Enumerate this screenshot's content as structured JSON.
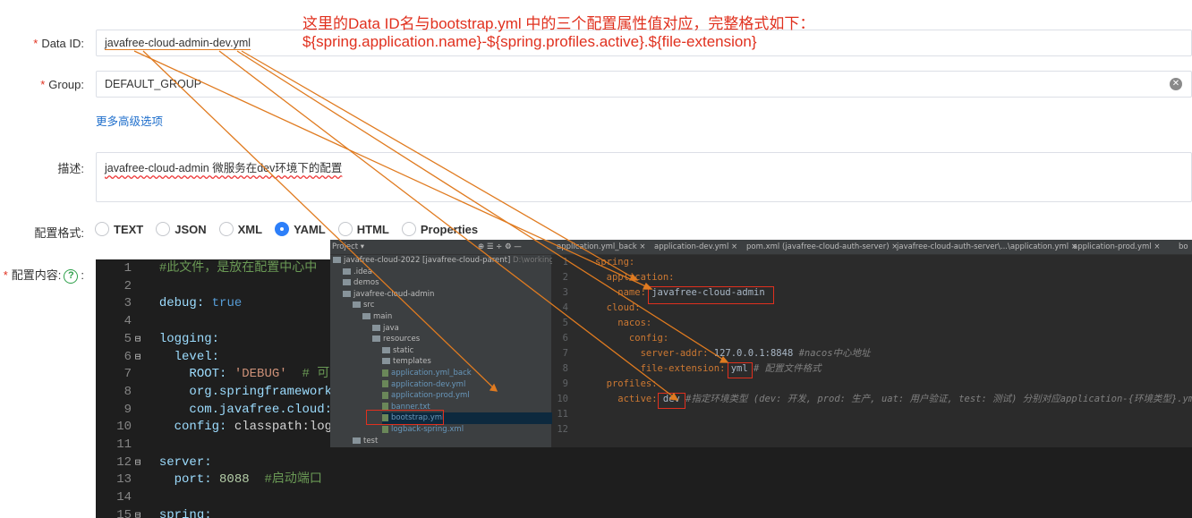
{
  "form": {
    "data_id_label": "Data ID:",
    "data_id_value": "javafree-cloud-admin-dev.yml",
    "group_label": "Group:",
    "group_value": "DEFAULT_GROUP",
    "advanced_link": "更多高级选项",
    "desc_label": "描述:",
    "desc_value": "javafree-cloud-admin 微服务在dev环境下的配置",
    "format_label": "配置格式:",
    "formats": [
      "TEXT",
      "JSON",
      "XML",
      "YAML",
      "HTML",
      "Properties"
    ],
    "selected_format": "YAML",
    "content_label": "配置内容:",
    "help_glyph": "?",
    "required_mark": "*",
    "colon": ":"
  },
  "annotation": {
    "line1": "这里的Data ID名与bootstrap.yml 中的三个配置属性值对应，完整格式如下：",
    "line2": "${spring.application.name}-${spring.profiles.active}.${file-extension}"
  },
  "editor": {
    "lines": [
      {
        "n": "1",
        "text": "#此文件，是放在配置中心中"
      },
      {
        "n": "2",
        "text": ""
      },
      {
        "n": "3",
        "key": "debug",
        "val": "true"
      },
      {
        "n": "4",
        "text": ""
      },
      {
        "n": "5",
        "key": "logging",
        "val": ""
      },
      {
        "n": "6",
        "key": "  level",
        "val": ""
      },
      {
        "n": "7",
        "key": "    ROOT",
        "val": "'DEBUG'",
        "comment": "# 可选"
      },
      {
        "n": "8",
        "text": "    org.springframework.c"
      },
      {
        "n": "9",
        "text": "    com.javafree.cloud:"
      },
      {
        "n": "10",
        "key": "  config",
        "val": "classpath:logba"
      },
      {
        "n": "11",
        "text": ""
      },
      {
        "n": "12",
        "key": "server",
        "val": ""
      },
      {
        "n": "13",
        "key": "  port",
        "val": "8088",
        "comment": "#启动端口"
      },
      {
        "n": "14",
        "text": ""
      },
      {
        "n": "15",
        "key": "spring",
        "val": ""
      }
    ]
  },
  "ide": {
    "tabs": [
      "application.yml_back",
      "application-dev.yml",
      "pom.xml (javafree-cloud-auth-server)",
      "javafree-cloud-auth-server\\...\\application.yml",
      "application-prod.yml",
      "bo"
    ],
    "project_label": "Project ▾",
    "tree": [
      {
        "text": "javafree-cloud-2022 [javafree-cloud-parent]",
        "suffix": "D:\\working\\javafre",
        "indent": 0,
        "type": "folder"
      },
      {
        "text": ".idea",
        "indent": 1,
        "type": "folder"
      },
      {
        "text": "demos",
        "indent": 1,
        "type": "folder"
      },
      {
        "text": "javafree-cloud-admin",
        "indent": 1,
        "type": "folder"
      },
      {
        "text": "src",
        "indent": 2,
        "type": "folder"
      },
      {
        "text": "main",
        "indent": 3,
        "type": "folder"
      },
      {
        "text": "java",
        "indent": 4,
        "type": "folder"
      },
      {
        "text": "resources",
        "indent": 4,
        "type": "folder"
      },
      {
        "text": "static",
        "indent": 5,
        "type": "folder"
      },
      {
        "text": "templates",
        "indent": 5,
        "type": "folder"
      },
      {
        "text": "application.yml_back",
        "indent": 5,
        "type": "file"
      },
      {
        "text": "application-dev.yml",
        "indent": 5,
        "type": "file"
      },
      {
        "text": "application-prod.yml",
        "indent": 5,
        "type": "file"
      },
      {
        "text": "banner.txt",
        "indent": 5,
        "type": "file"
      },
      {
        "text": "bootstrap.yml",
        "indent": 5,
        "type": "file"
      },
      {
        "text": "logback-spring.xml",
        "indent": 5,
        "type": "file"
      },
      {
        "text": "test",
        "indent": 2,
        "type": "folder"
      }
    ],
    "code": [
      {
        "n": "1",
        "k": "spring:",
        "v": "",
        "c": ""
      },
      {
        "n": "2",
        "k": "  application:",
        "v": "",
        "c": ""
      },
      {
        "n": "3",
        "k": "    name:",
        "v": " javafree-cloud-admin",
        "c": ""
      },
      {
        "n": "4",
        "k": "  cloud:",
        "v": "",
        "c": ""
      },
      {
        "n": "5",
        "k": "    nacos:",
        "v": "",
        "c": ""
      },
      {
        "n": "6",
        "k": "      config:",
        "v": "",
        "c": ""
      },
      {
        "n": "7",
        "k": "        server-addr:",
        "v": " 127.0.0.1:8848",
        "c": " #nacos中心地址"
      },
      {
        "n": "8",
        "k": "        file-extension:",
        "v": " yml",
        "c": " # 配置文件格式"
      },
      {
        "n": "9",
        "k": "  profiles:",
        "v": "",
        "c": ""
      },
      {
        "n": "10",
        "k": "    active:",
        "v": " dev",
        "c": " #指定环境类型 (dev: 开发, prod: 生产, uat: 用户验证, test: 测试) 分别对应application-{环境类型}.yml文件"
      },
      {
        "n": "11",
        "k": "",
        "v": "",
        "c": ""
      },
      {
        "n": "12",
        "k": "",
        "v": "",
        "c": ""
      }
    ]
  }
}
